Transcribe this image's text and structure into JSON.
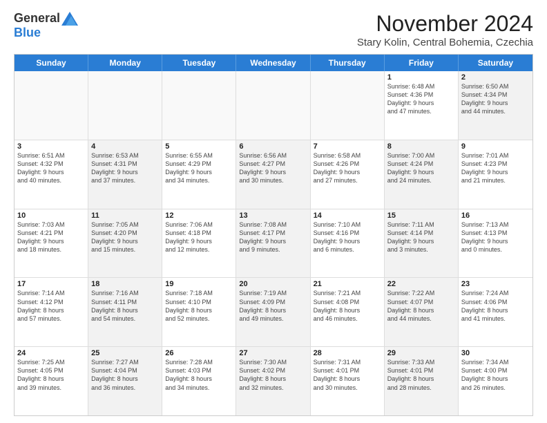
{
  "logo": {
    "general": "General",
    "blue": "Blue"
  },
  "title": "November 2024",
  "location": "Stary Kolin, Central Bohemia, Czechia",
  "header_days": [
    "Sunday",
    "Monday",
    "Tuesday",
    "Wednesday",
    "Thursday",
    "Friday",
    "Saturday"
  ],
  "rows": [
    [
      {
        "day": "",
        "info": "",
        "shaded": false,
        "empty": true
      },
      {
        "day": "",
        "info": "",
        "shaded": false,
        "empty": true
      },
      {
        "day": "",
        "info": "",
        "shaded": false,
        "empty": true
      },
      {
        "day": "",
        "info": "",
        "shaded": false,
        "empty": true
      },
      {
        "day": "",
        "info": "",
        "shaded": false,
        "empty": true
      },
      {
        "day": "1",
        "info": "Sunrise: 6:48 AM\nSunset: 4:36 PM\nDaylight: 9 hours\nand 47 minutes.",
        "shaded": false,
        "empty": false
      },
      {
        "day": "2",
        "info": "Sunrise: 6:50 AM\nSunset: 4:34 PM\nDaylight: 9 hours\nand 44 minutes.",
        "shaded": true,
        "empty": false
      }
    ],
    [
      {
        "day": "3",
        "info": "Sunrise: 6:51 AM\nSunset: 4:32 PM\nDaylight: 9 hours\nand 40 minutes.",
        "shaded": false,
        "empty": false
      },
      {
        "day": "4",
        "info": "Sunrise: 6:53 AM\nSunset: 4:31 PM\nDaylight: 9 hours\nand 37 minutes.",
        "shaded": true,
        "empty": false
      },
      {
        "day": "5",
        "info": "Sunrise: 6:55 AM\nSunset: 4:29 PM\nDaylight: 9 hours\nand 34 minutes.",
        "shaded": false,
        "empty": false
      },
      {
        "day": "6",
        "info": "Sunrise: 6:56 AM\nSunset: 4:27 PM\nDaylight: 9 hours\nand 30 minutes.",
        "shaded": true,
        "empty": false
      },
      {
        "day": "7",
        "info": "Sunrise: 6:58 AM\nSunset: 4:26 PM\nDaylight: 9 hours\nand 27 minutes.",
        "shaded": false,
        "empty": false
      },
      {
        "day": "8",
        "info": "Sunrise: 7:00 AM\nSunset: 4:24 PM\nDaylight: 9 hours\nand 24 minutes.",
        "shaded": true,
        "empty": false
      },
      {
        "day": "9",
        "info": "Sunrise: 7:01 AM\nSunset: 4:23 PM\nDaylight: 9 hours\nand 21 minutes.",
        "shaded": false,
        "empty": false
      }
    ],
    [
      {
        "day": "10",
        "info": "Sunrise: 7:03 AM\nSunset: 4:21 PM\nDaylight: 9 hours\nand 18 minutes.",
        "shaded": false,
        "empty": false
      },
      {
        "day": "11",
        "info": "Sunrise: 7:05 AM\nSunset: 4:20 PM\nDaylight: 9 hours\nand 15 minutes.",
        "shaded": true,
        "empty": false
      },
      {
        "day": "12",
        "info": "Sunrise: 7:06 AM\nSunset: 4:18 PM\nDaylight: 9 hours\nand 12 minutes.",
        "shaded": false,
        "empty": false
      },
      {
        "day": "13",
        "info": "Sunrise: 7:08 AM\nSunset: 4:17 PM\nDaylight: 9 hours\nand 9 minutes.",
        "shaded": true,
        "empty": false
      },
      {
        "day": "14",
        "info": "Sunrise: 7:10 AM\nSunset: 4:16 PM\nDaylight: 9 hours\nand 6 minutes.",
        "shaded": false,
        "empty": false
      },
      {
        "day": "15",
        "info": "Sunrise: 7:11 AM\nSunset: 4:14 PM\nDaylight: 9 hours\nand 3 minutes.",
        "shaded": true,
        "empty": false
      },
      {
        "day": "16",
        "info": "Sunrise: 7:13 AM\nSunset: 4:13 PM\nDaylight: 9 hours\nand 0 minutes.",
        "shaded": false,
        "empty": false
      }
    ],
    [
      {
        "day": "17",
        "info": "Sunrise: 7:14 AM\nSunset: 4:12 PM\nDaylight: 8 hours\nand 57 minutes.",
        "shaded": false,
        "empty": false
      },
      {
        "day": "18",
        "info": "Sunrise: 7:16 AM\nSunset: 4:11 PM\nDaylight: 8 hours\nand 54 minutes.",
        "shaded": true,
        "empty": false
      },
      {
        "day": "19",
        "info": "Sunrise: 7:18 AM\nSunset: 4:10 PM\nDaylight: 8 hours\nand 52 minutes.",
        "shaded": false,
        "empty": false
      },
      {
        "day": "20",
        "info": "Sunrise: 7:19 AM\nSunset: 4:09 PM\nDaylight: 8 hours\nand 49 minutes.",
        "shaded": true,
        "empty": false
      },
      {
        "day": "21",
        "info": "Sunrise: 7:21 AM\nSunset: 4:08 PM\nDaylight: 8 hours\nand 46 minutes.",
        "shaded": false,
        "empty": false
      },
      {
        "day": "22",
        "info": "Sunrise: 7:22 AM\nSunset: 4:07 PM\nDaylight: 8 hours\nand 44 minutes.",
        "shaded": true,
        "empty": false
      },
      {
        "day": "23",
        "info": "Sunrise: 7:24 AM\nSunset: 4:06 PM\nDaylight: 8 hours\nand 41 minutes.",
        "shaded": false,
        "empty": false
      }
    ],
    [
      {
        "day": "24",
        "info": "Sunrise: 7:25 AM\nSunset: 4:05 PM\nDaylight: 8 hours\nand 39 minutes.",
        "shaded": false,
        "empty": false
      },
      {
        "day": "25",
        "info": "Sunrise: 7:27 AM\nSunset: 4:04 PM\nDaylight: 8 hours\nand 36 minutes.",
        "shaded": true,
        "empty": false
      },
      {
        "day": "26",
        "info": "Sunrise: 7:28 AM\nSunset: 4:03 PM\nDaylight: 8 hours\nand 34 minutes.",
        "shaded": false,
        "empty": false
      },
      {
        "day": "27",
        "info": "Sunrise: 7:30 AM\nSunset: 4:02 PM\nDaylight: 8 hours\nand 32 minutes.",
        "shaded": true,
        "empty": false
      },
      {
        "day": "28",
        "info": "Sunrise: 7:31 AM\nSunset: 4:01 PM\nDaylight: 8 hours\nand 30 minutes.",
        "shaded": false,
        "empty": false
      },
      {
        "day": "29",
        "info": "Sunrise: 7:33 AM\nSunset: 4:01 PM\nDaylight: 8 hours\nand 28 minutes.",
        "shaded": true,
        "empty": false
      },
      {
        "day": "30",
        "info": "Sunrise: 7:34 AM\nSunset: 4:00 PM\nDaylight: 8 hours\nand 26 minutes.",
        "shaded": false,
        "empty": false
      }
    ]
  ]
}
